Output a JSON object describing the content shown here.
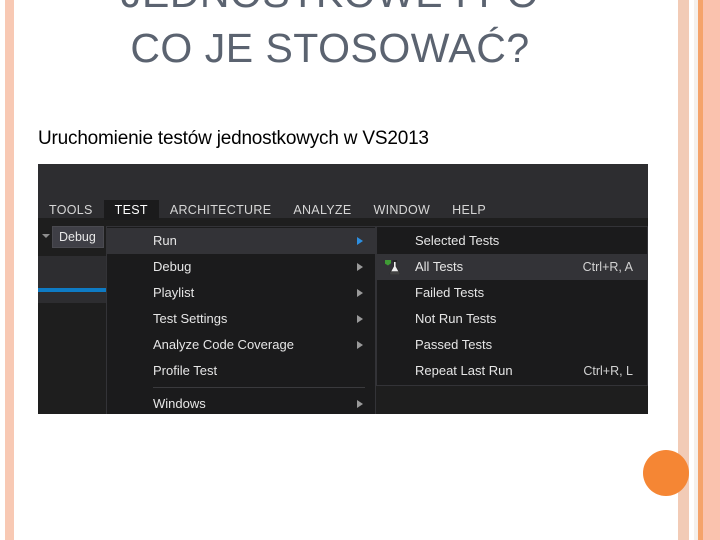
{
  "slide": {
    "title": "JEDNOSTKOWE I PO\nCO JE STOSOWAĆ?",
    "subtitle": "Uruchomienie testów jednostkowych w VS2013",
    "title_color": "#5b6370",
    "accent_color": "#f58634",
    "border_color": "#f8c9b4"
  },
  "vs_screenshot": {
    "menubar": {
      "items": [
        {
          "label": "TOOLS",
          "active": false
        },
        {
          "label": "TEST",
          "active": true
        },
        {
          "label": "ARCHITECTURE",
          "active": false
        },
        {
          "label": "ANALYZE",
          "active": false
        },
        {
          "label": "WINDOW",
          "active": false
        },
        {
          "label": "HELP",
          "active": false
        }
      ]
    },
    "toolbar": {
      "configuration_value": "Debug"
    },
    "test_menu": {
      "items": [
        {
          "label": "Run",
          "has_submenu": true,
          "highlighted": true,
          "separator_after": false
        },
        {
          "label": "Debug",
          "has_submenu": true,
          "highlighted": false,
          "separator_after": false
        },
        {
          "label": "Playlist",
          "has_submenu": true,
          "highlighted": false,
          "separator_after": false
        },
        {
          "label": "Test Settings",
          "has_submenu": true,
          "highlighted": false,
          "separator_after": false
        },
        {
          "label": "Analyze Code Coverage",
          "has_submenu": true,
          "highlighted": false,
          "separator_after": false
        },
        {
          "label": "Profile Test",
          "has_submenu": false,
          "highlighted": false,
          "separator_after": true
        },
        {
          "label": "Windows",
          "has_submenu": true,
          "highlighted": false,
          "separator_after": false
        }
      ]
    },
    "run_submenu": {
      "items": [
        {
          "label": "Selected Tests",
          "shortcut": "",
          "highlighted": false,
          "icon": ""
        },
        {
          "label": "All Tests",
          "shortcut": "Ctrl+R, A",
          "highlighted": true,
          "icon": "run-test-flask-icon"
        },
        {
          "label": "Failed Tests",
          "shortcut": "",
          "highlighted": false,
          "icon": ""
        },
        {
          "label": "Not Run Tests",
          "shortcut": "",
          "highlighted": false,
          "icon": ""
        },
        {
          "label": "Passed Tests",
          "shortcut": "",
          "highlighted": false,
          "icon": ""
        },
        {
          "label": "Repeat Last Run",
          "shortcut": "Ctrl+R, L",
          "highlighted": false,
          "icon": ""
        }
      ]
    }
  }
}
